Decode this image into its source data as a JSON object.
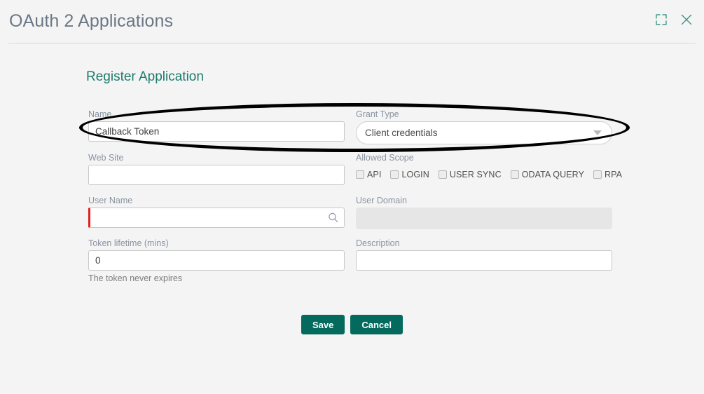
{
  "header": {
    "title": "OAuth 2 Applications",
    "actions": [
      {
        "name": "expand-icon",
        "label": "Expand"
      },
      {
        "name": "close-icon",
        "label": "Close"
      }
    ],
    "accent_color": "#41998a"
  },
  "form": {
    "section_title": "Register Application",
    "fields": {
      "name": {
        "label": "Name",
        "value": "Callback Token",
        "placeholder": ""
      },
      "grant_type": {
        "label": "Grant Type",
        "value": "Client credentials"
      },
      "web_site": {
        "label": "Web Site",
        "value": "",
        "placeholder": ""
      },
      "allowed_scope": {
        "label": "Allowed Scope",
        "options": [
          {
            "label": "API",
            "checked": false
          },
          {
            "label": "LOGIN",
            "checked": false
          },
          {
            "label": "USER SYNC",
            "checked": false
          },
          {
            "label": "ODATA QUERY",
            "checked": false
          },
          {
            "label": "RPA",
            "checked": false
          }
        ]
      },
      "user_name": {
        "label": "User Name",
        "value": "",
        "placeholder": "",
        "required": true
      },
      "user_domain": {
        "label": "User Domain",
        "value": "",
        "placeholder": "",
        "disabled": true
      },
      "token_lifetime": {
        "label": "Token lifetime (mins)",
        "value": "0",
        "hint": "The token never expires"
      },
      "description": {
        "label": "Description",
        "value": "",
        "placeholder": ""
      }
    },
    "buttons": {
      "save": "Save",
      "cancel": "Cancel"
    },
    "button_color": "#046a5d",
    "section_title_color": "#1c7a6d",
    "required_marker_color": "#e02020"
  },
  "annotation": {
    "shape": "ellipse",
    "color": "#000000",
    "highlights": "Name and Grant Type fields"
  }
}
